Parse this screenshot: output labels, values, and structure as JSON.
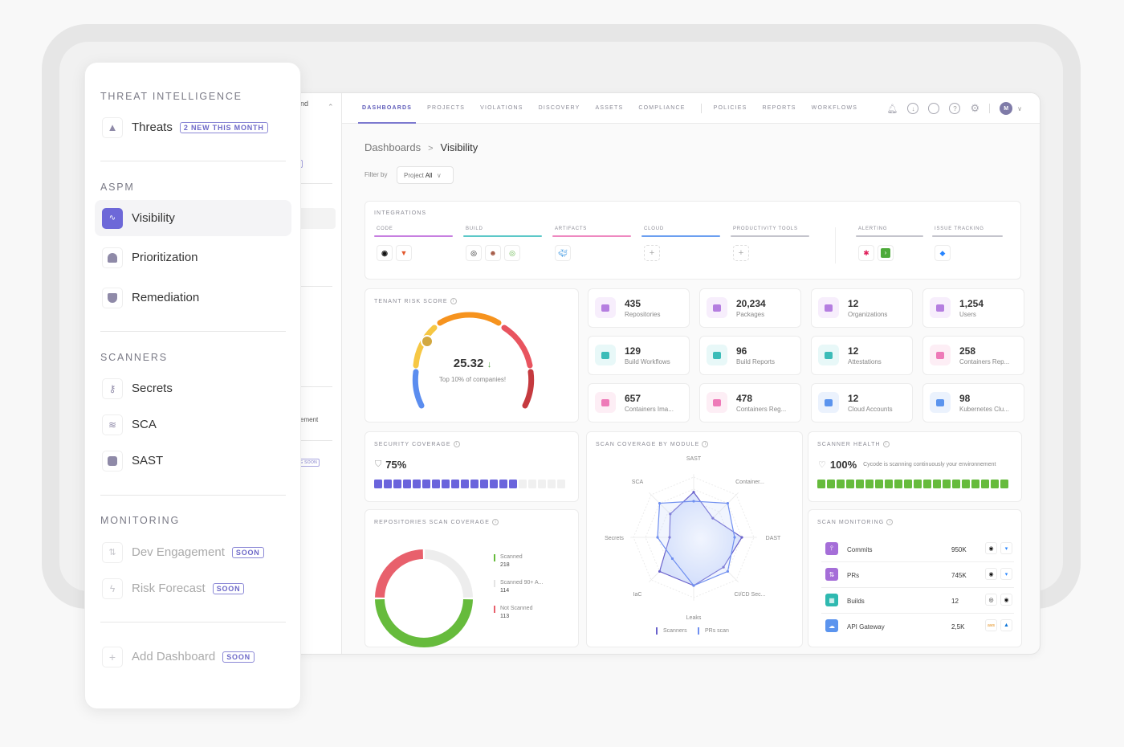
{
  "sidebar": {
    "sections": [
      {
        "title": "THREAT INTELLIGENCE",
        "items": [
          {
            "label": "Threats",
            "badge": "2 NEW THIS MONTH",
            "icon": "warning-icon"
          }
        ]
      },
      {
        "title": "ASPM",
        "items": [
          {
            "label": "Visibility",
            "icon": "pulse-icon",
            "active": true
          },
          {
            "label": "Prioritization",
            "icon": "gauge-icon"
          },
          {
            "label": "Remediation",
            "icon": "shield-check-icon"
          }
        ]
      },
      {
        "title": "SCANNERS",
        "items": [
          {
            "label": "Secrets",
            "icon": "key-icon"
          },
          {
            "label": "SCA",
            "icon": "layers-icon"
          },
          {
            "label": "SAST",
            "icon": "terminal-icon"
          }
        ]
      },
      {
        "title": "MONITORING",
        "items": [
          {
            "label": "Dev Engagement",
            "badge": "SOON",
            "icon": "git-compare-icon",
            "disabled": true
          },
          {
            "label": "Risk Forecast",
            "badge": "SOON",
            "icon": "lightning-icon",
            "disabled": true
          }
        ]
      }
    ],
    "add_dashboard": {
      "label": "Add Dashboard",
      "badge": "SOON"
    }
  },
  "background_sidebar": {
    "workspace_fragment": "nd",
    "badge_fragment": "ONTH",
    "item_fragment": "ement",
    "soon_fragment": "OMING SOON"
  },
  "topnav": {
    "tabs": [
      "DASHBOARDS",
      "PROJECTS",
      "VIOLATIONS",
      "DISCOVERY",
      "ASSETS",
      "COMPLIANCE",
      "POLICIES",
      "REPORTS",
      "WORKFLOWS"
    ],
    "active_tab": "DASHBOARDS",
    "icons": [
      "bell-icon",
      "download-icon",
      "chat-icon",
      "help-icon",
      "settings-icon"
    ],
    "avatar_initial": "M"
  },
  "breadcrumb": {
    "parent": "Dashboards",
    "separator": ">",
    "current": "Visibility"
  },
  "filter": {
    "label": "Filter by",
    "select_prefix": "Project",
    "select_value": "All"
  },
  "integrations": {
    "title": "INTEGRATIONS",
    "columns": [
      {
        "label": "CODE",
        "color": "#c77fe0",
        "tools": [
          "github",
          "gitlab"
        ]
      },
      {
        "label": "BUILD",
        "color": "#5cc8c8",
        "tools": [
          "circleci",
          "jenkins",
          "argo"
        ]
      },
      {
        "label": "ARTIFACTS",
        "color": "#ee88c0",
        "tools": [
          "docker"
        ]
      },
      {
        "label": "CLOUD",
        "color": "#6b9ff0",
        "tools": [
          "+"
        ]
      },
      {
        "label": "PRODUCTIVITY TOOLS",
        "color": "#c4c4cc",
        "tools": [
          "+"
        ]
      },
      {
        "label": "ALERTING",
        "color": "#c4c4cc",
        "tools": [
          "slack",
          "terminal"
        ]
      },
      {
        "label": "ISSUE TRACKING",
        "color": "#c4c4cc",
        "tools": [
          "jira"
        ]
      }
    ]
  },
  "tenant_risk": {
    "title": "TENANT RISK SCORE",
    "score": "25.32",
    "trend": "↓",
    "caption": "Top 10% of companies!",
    "score_fraction": 0.22
  },
  "stats": [
    {
      "value": "435",
      "label": "Repositories",
      "icon": "folder-icon",
      "color": "#b57ee0",
      "bg": "#f7eefc"
    },
    {
      "value": "20,234",
      "label": "Packages",
      "icon": "package-icon",
      "color": "#b57ee0",
      "bg": "#f7eefc"
    },
    {
      "value": "12",
      "label": "Organizations",
      "icon": "building-icon",
      "color": "#b57ee0",
      "bg": "#f7eefc"
    },
    {
      "value": "1,254",
      "label": "Users",
      "icon": "user-icon",
      "color": "#b57ee0",
      "bg": "#f7eefc"
    },
    {
      "value": "129",
      "label": "Build Workflows",
      "icon": "workflow-icon",
      "color": "#3cbcb8",
      "bg": "#e8f8f8"
    },
    {
      "value": "96",
      "label": "Build Reports",
      "icon": "report-icon",
      "color": "#3cbcb8",
      "bg": "#e8f8f8"
    },
    {
      "value": "12",
      "label": "Attestations",
      "icon": "medal-icon",
      "color": "#3cbcb8",
      "bg": "#e8f8f8"
    },
    {
      "value": "258",
      "label": "Containers Rep...",
      "icon": "container-icon",
      "color": "#ee7ab8",
      "bg": "#fdeef5"
    },
    {
      "value": "657",
      "label": "Containers Ima...",
      "icon": "container-icon",
      "color": "#ee7ab8",
      "bg": "#fdeef5"
    },
    {
      "value": "478",
      "label": "Containers Reg...",
      "icon": "container-icon",
      "color": "#ee7ab8",
      "bg": "#fdeef5"
    },
    {
      "value": "12",
      "label": "Cloud Accounts",
      "icon": "cloud-icon",
      "color": "#5b94ee",
      "bg": "#ebf2fd"
    },
    {
      "value": "98",
      "label": "Kubernetes Clu...",
      "icon": "kubernetes-icon",
      "color": "#5b94ee",
      "bg": "#ebf2fd"
    }
  ],
  "security_coverage": {
    "title": "SECURITY COVERAGE",
    "value": "75%",
    "fraction": 0.75
  },
  "scanner_health": {
    "title": "SCANNER HEALTH",
    "value": "100%",
    "caption": "Cycode is scanning continuously your environnement",
    "fraction": 1.0
  },
  "repo_scan": {
    "title": "REPOSITORIES SCAN COVERAGE",
    "items": [
      {
        "label": "Scanned",
        "value": "218",
        "color": "#66bb3c"
      },
      {
        "label": "Scanned 90+ A...",
        "value": "114",
        "color": "#ededed"
      },
      {
        "label": "Not Scanned",
        "value": "113",
        "color": "#e8606c"
      }
    ]
  },
  "chart_data": {
    "type": "radar",
    "title": "SCAN COVERAGE BY MODULE",
    "axes": [
      "SAST",
      "Container...",
      "DAST",
      "CI/CD Sec...",
      "Leaks",
      "IaC",
      "Secrets",
      "SCA"
    ],
    "series": [
      {
        "name": "Scanners",
        "color": "#6a62cc",
        "values": [
          0.75,
          0.45,
          0.8,
          0.7,
          0.8,
          0.8,
          0.4,
          0.55
        ]
      },
      {
        "name": "PRs scan",
        "color": "#6f8ff0",
        "values": [
          0.6,
          0.8,
          0.68,
          0.8,
          0.8,
          0.5,
          0.6,
          0.8
        ]
      }
    ],
    "range": [
      0,
      1
    ]
  },
  "scan_monitoring": {
    "title": "SCAN MONITORING",
    "rows": [
      {
        "label": "Commits",
        "value": "950K",
        "icon": "commit-icon",
        "color": "#a56ed8",
        "sources": [
          "github",
          "bitbucket"
        ]
      },
      {
        "label": "PRs",
        "value": "745K",
        "icon": "pull-request-icon",
        "color": "#a56ed8",
        "sources": [
          "github",
          "bitbucket"
        ]
      },
      {
        "label": "Builds",
        "value": "12",
        "icon": "build-icon",
        "color": "#2fb9b0",
        "sources": [
          "circleci",
          "github"
        ]
      },
      {
        "label": "API Gateway",
        "value": "2,5K",
        "icon": "cloud-icon",
        "color": "#5b94ee",
        "sources": [
          "aws",
          "azure"
        ]
      }
    ]
  }
}
